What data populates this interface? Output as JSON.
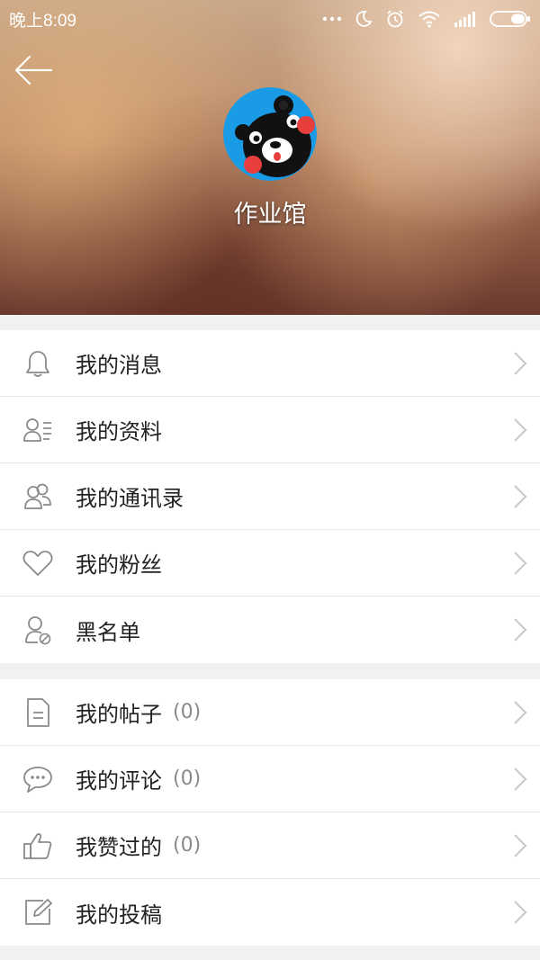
{
  "status_bar": {
    "time": "晚上8:09",
    "icons": [
      "more-dots-icon",
      "moon-icon",
      "alarm-icon",
      "wifi-icon",
      "signal-icon",
      "battery-icon"
    ]
  },
  "header": {
    "username": "作业馆",
    "back_icon": "back-arrow-icon",
    "avatar": "kumamon-bear"
  },
  "menu_group_1": [
    {
      "label": "我的消息",
      "icon": "bell-icon"
    },
    {
      "label": "我的资料",
      "icon": "profile-card-icon"
    },
    {
      "label": "我的通讯录",
      "icon": "contacts-icon"
    },
    {
      "label": "我的粉丝",
      "icon": "heart-icon"
    },
    {
      "label": "黑名单",
      "icon": "blocked-user-icon"
    }
  ],
  "menu_group_2": [
    {
      "label": "我的帖子",
      "count": "(0)",
      "icon": "document-icon"
    },
    {
      "label": "我的评论",
      "count": "(0)",
      "icon": "comment-icon"
    },
    {
      "label": "我赞过的",
      "count": "(0)",
      "icon": "thumbs-up-icon"
    },
    {
      "label": "我的投稿",
      "icon": "edit-icon"
    }
  ]
}
